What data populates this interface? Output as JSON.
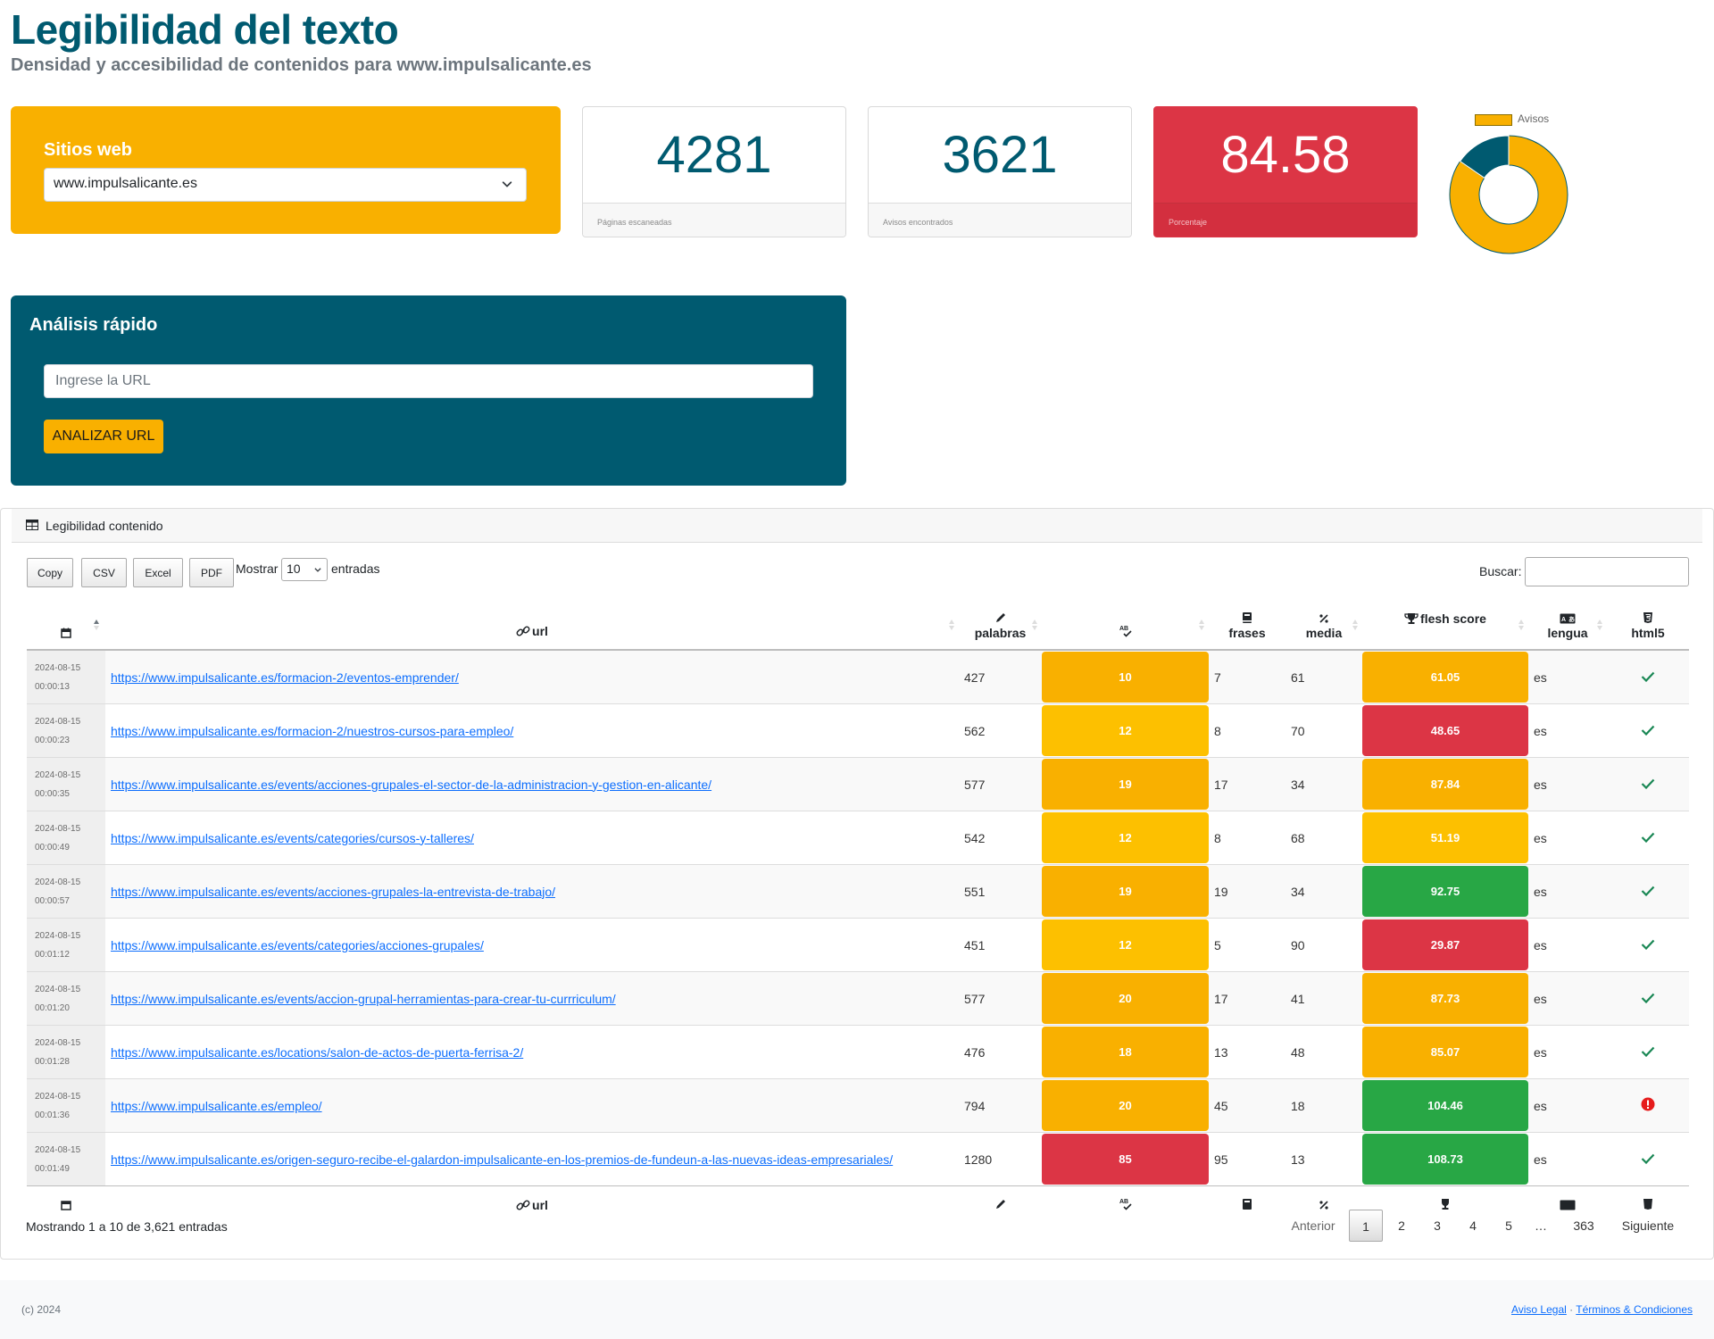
{
  "header": {
    "title": "Legibilidad del texto",
    "subtitle": "Densidad y accesibilidad de contenidos para www.impulsalicante.es"
  },
  "site_card": {
    "label": "Sitios web",
    "selected": "www.impulsalicante.es"
  },
  "stats": [
    {
      "value": "4281",
      "caption": "Páginas escaneadas"
    },
    {
      "value": "3621",
      "caption": "Avisos encontrados"
    },
    {
      "value": "84.58",
      "caption": "Porcentaje"
    }
  ],
  "donut": {
    "legend": "Avisos",
    "primary_fraction": 0.8458,
    "colors": {
      "primary": "#f9b000",
      "secondary": "#005a70"
    }
  },
  "quick": {
    "title": "Análisis rápido",
    "placeholder": "Ingrese la URL",
    "button": "ANALIZAR URL"
  },
  "table_card": {
    "title": "Legibilidad contenido",
    "buttons": [
      "Copy",
      "CSV",
      "Excel",
      "PDF"
    ],
    "show_label": "Mostrar",
    "show_value": "10",
    "entries_label": "entradas",
    "search_label": "Buscar:",
    "headers": {
      "url": "url",
      "palabras": "palabras",
      "frases": "frases",
      "media": "media",
      "flesh": "flesh score",
      "lengua": "lengua",
      "html5": "html5"
    },
    "footer_headers": {
      "url": "url"
    },
    "rows": [
      {
        "date": "2024-08-15",
        "time": "00:00:13",
        "url": "https://www.impulsalicante.es/formacion-2/eventos-emprender/",
        "palabras": "427",
        "ab": "10",
        "ab_color": "orange",
        "frases": "7",
        "media": "61",
        "flesh": "61.05",
        "flesh_color": "orange",
        "lengua": "es",
        "html5": "ok"
      },
      {
        "date": "2024-08-15",
        "time": "00:00:23",
        "url": "https://www.impulsalicante.es/formacion-2/nuestros-cursos-para-empleo/",
        "palabras": "562",
        "ab": "12",
        "ab_color": "yellow",
        "frases": "8",
        "media": "70",
        "flesh": "48.65",
        "flesh_color": "red",
        "lengua": "es",
        "html5": "ok"
      },
      {
        "date": "2024-08-15",
        "time": "00:00:35",
        "url": "https://www.impulsalicante.es/events/acciones-grupales-el-sector-de-la-administracion-y-gestion-en-alicante/",
        "palabras": "577",
        "ab": "19",
        "ab_color": "orange",
        "frases": "17",
        "media": "34",
        "flesh": "87.84",
        "flesh_color": "orange",
        "lengua": "es",
        "html5": "ok"
      },
      {
        "date": "2024-08-15",
        "time": "00:00:49",
        "url": "https://www.impulsalicante.es/events/categories/cursos-y-talleres/",
        "palabras": "542",
        "ab": "12",
        "ab_color": "yellow",
        "frases": "8",
        "media": "68",
        "flesh": "51.19",
        "flesh_color": "yellow",
        "lengua": "es",
        "html5": "ok"
      },
      {
        "date": "2024-08-15",
        "time": "00:00:57",
        "url": "https://www.impulsalicante.es/events/acciones-grupales-la-entrevista-de-trabajo/",
        "palabras": "551",
        "ab": "19",
        "ab_color": "orange",
        "frases": "19",
        "media": "34",
        "flesh": "92.75",
        "flesh_color": "green",
        "lengua": "es",
        "html5": "ok"
      },
      {
        "date": "2024-08-15",
        "time": "00:01:12",
        "url": "https://www.impulsalicante.es/events/categories/acciones-grupales/",
        "palabras": "451",
        "ab": "12",
        "ab_color": "yellow",
        "frases": "5",
        "media": "90",
        "flesh": "29.87",
        "flesh_color": "red",
        "lengua": "es",
        "html5": "ok"
      },
      {
        "date": "2024-08-15",
        "time": "00:01:20",
        "url": "https://www.impulsalicante.es/events/accion-grupal-herramientas-para-crear-tu-currriculum/",
        "palabras": "577",
        "ab": "20",
        "ab_color": "orange",
        "frases": "17",
        "media": "41",
        "flesh": "87.73",
        "flesh_color": "orange",
        "lengua": "es",
        "html5": "ok"
      },
      {
        "date": "2024-08-15",
        "time": "00:01:28",
        "url": "https://www.impulsalicante.es/locations/salon-de-actos-de-puerta-ferrisa-2/",
        "palabras": "476",
        "ab": "18",
        "ab_color": "orange",
        "frases": "13",
        "media": "48",
        "flesh": "85.07",
        "flesh_color": "orange",
        "lengua": "es",
        "html5": "ok"
      },
      {
        "date": "2024-08-15",
        "time": "00:01:36",
        "url": "https://www.impulsalicante.es/empleo/",
        "palabras": "794",
        "ab": "20",
        "ab_color": "orange",
        "frases": "45",
        "media": "18",
        "flesh": "104.46",
        "flesh_color": "green",
        "lengua": "es",
        "html5": "error"
      },
      {
        "date": "2024-08-15",
        "time": "00:01:49",
        "url": "https://www.impulsalicante.es/origen-seguro-recibe-el-galardon-impulsalicante-en-los-premios-de-fundeun-a-las-nuevas-ideas-empresariales/",
        "palabras": "1280",
        "ab": "85",
        "ab_color": "red",
        "frases": "95",
        "media": "13",
        "flesh": "108.73",
        "flesh_color": "green",
        "lengua": "es",
        "html5": "ok"
      }
    ],
    "info": "Mostrando 1 a 10 de 3,621 entradas",
    "pagination": {
      "prev": "Anterior",
      "pages": [
        "1",
        "2",
        "3",
        "4",
        "5",
        "…",
        "363"
      ],
      "current": "1",
      "next": "Siguiente"
    }
  },
  "colors": {
    "brand": "#005a70",
    "accent": "#f9b000",
    "danger": "#dc3545",
    "success": "#28a745",
    "warning": "#fdc000"
  },
  "footer": {
    "copyright": "(c) 2024",
    "links": [
      "Aviso Legal",
      "Términos & Condiciones"
    ],
    "separator": "·"
  }
}
